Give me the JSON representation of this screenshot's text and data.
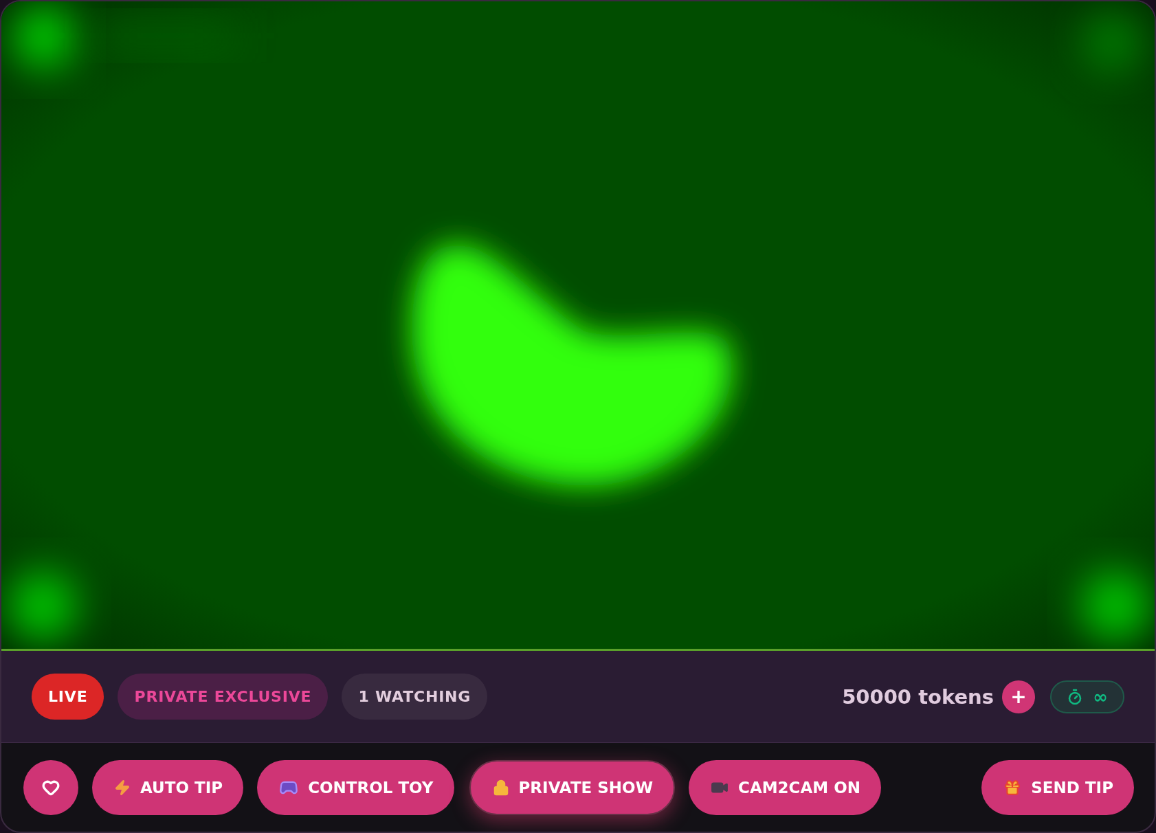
{
  "status": {
    "badges": [
      {
        "kind": "live",
        "label": "LIVE"
      },
      {
        "kind": "mode",
        "label": "PRIVATE EXCLUSIVE"
      },
      {
        "kind": "viewers",
        "label": "1 WATCHING"
      }
    ],
    "balance": "50000 tokens",
    "add_button": "+",
    "timer": "∞"
  },
  "actions": [
    {
      "kind": "like",
      "selected": false
    },
    {
      "kind": "autotip",
      "label": "AUTO TIP",
      "selected": false
    },
    {
      "kind": "toy",
      "label": "CONTROL TOY",
      "selected": false
    },
    {
      "kind": "private",
      "label": "PRIVATE SHOW",
      "selected": true
    },
    {
      "kind": "cam",
      "label": "CAM2CAM ON",
      "selected": false
    },
    {
      "kind": "tip",
      "label": "SEND TIP",
      "selected": false
    }
  ]
}
